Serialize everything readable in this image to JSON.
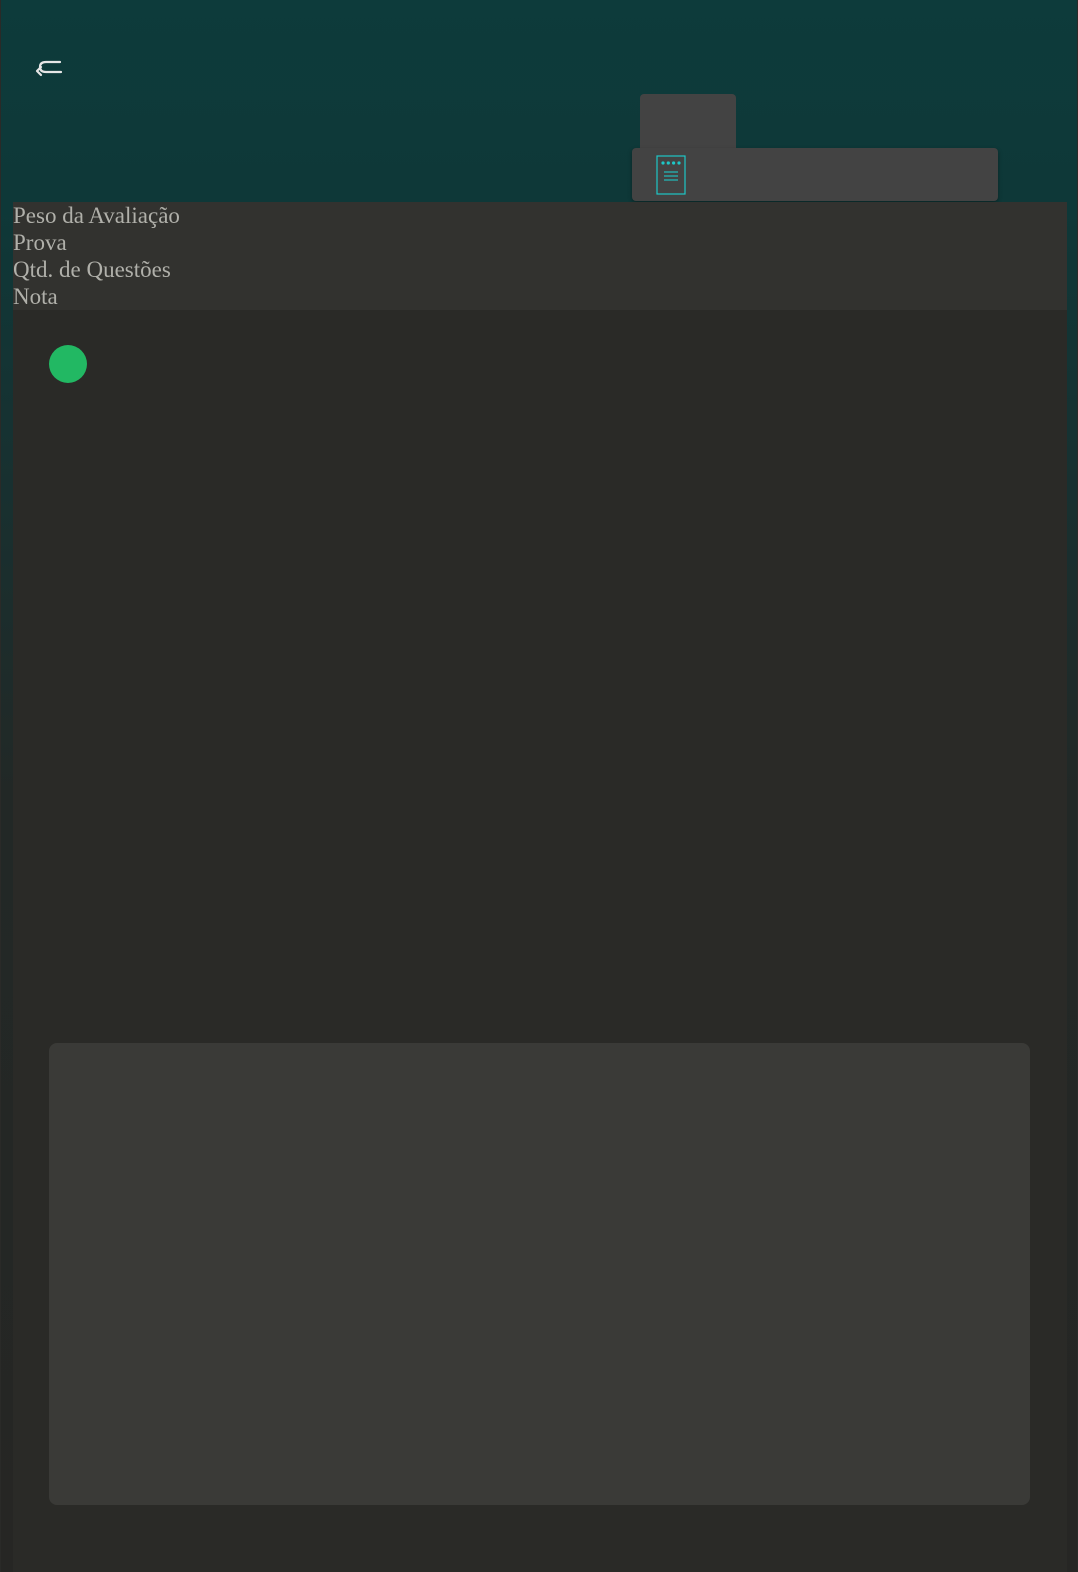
{
  "header": {
    "back_icon": "return-arrow-icon",
    "tab_icon": "document-icon"
  },
  "info": {
    "labels": [
      "Peso da Avaliação",
      "Prova",
      "Qtd. de Questões",
      "Nota"
    ]
  },
  "status": {
    "color": "#22b863"
  },
  "colors": {
    "accent": "#1ec7c7",
    "header_bg": "#0d3b3b",
    "panel_bg": "#434343"
  }
}
